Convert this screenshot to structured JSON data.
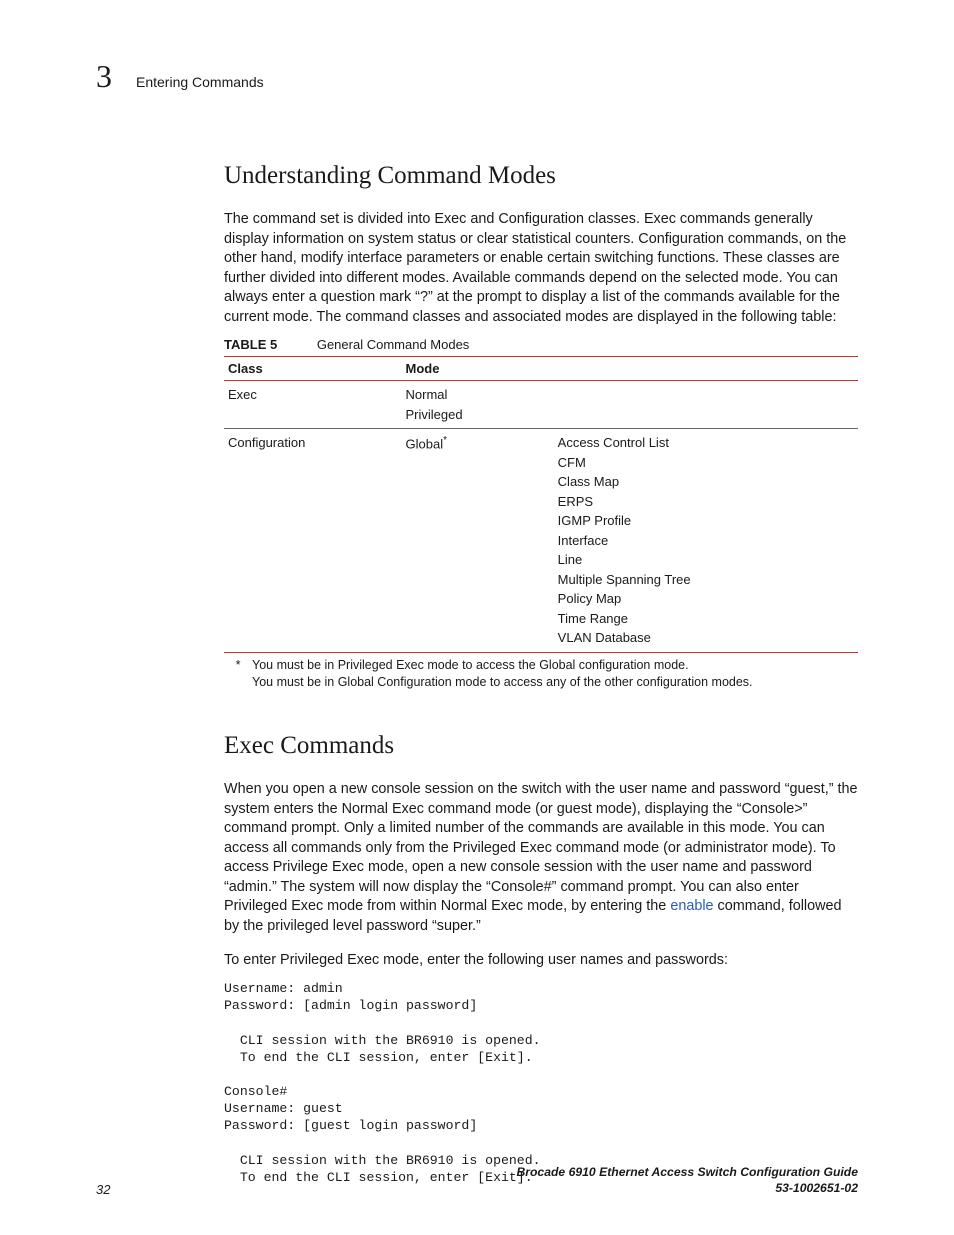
{
  "header": {
    "chapter_number": "3",
    "chapter_label": "Entering Commands"
  },
  "section1": {
    "title": "Understanding Command Modes",
    "para": "The command set is divided into Exec and Configuration classes. Exec commands generally display information on system status or clear statistical counters. Configuration commands, on the other hand, modify interface parameters or enable certain switching functions. These classes are further divided into different modes. Available commands depend on the selected mode. You can always enter a question mark “?” at the prompt to display a list of the commands available for the current mode. The command classes and associated modes are displayed in the following table:"
  },
  "table5": {
    "label": "TABLE 5",
    "title": "General Command Modes",
    "head_class": "Class",
    "head_mode": "Mode",
    "row_exec_class": "Exec",
    "row_exec_mode1": "Normal",
    "row_exec_mode2": "Privileged",
    "row_cfg_class": "Configuration",
    "row_cfg_mode": "Global",
    "cfg_sub": {
      "i0": "Access Control List",
      "i1": "CFM",
      "i2": "Class Map",
      "i3": "ERPS",
      "i4": "IGMP Profile",
      "i5": "Interface",
      "i6": "Line",
      "i7": "Multiple Spanning Tree",
      "i8": "Policy Map",
      "i9": "Time Range",
      "i10": "VLAN Database"
    }
  },
  "footnote": {
    "marker": "*",
    "line1": "You must be in Privileged Exec mode to access the Global configuration mode.",
    "line2": "You must be in Global Configuration mode to access any of the other configuration modes."
  },
  "section2": {
    "title": "Exec Commands",
    "para_pre": "When you open a new console session on the switch with the user name and password “guest,” the system enters the Normal Exec command mode (or guest mode), displaying the “Console>” command prompt. Only a limited number of the commands are available in this mode. You can access all commands only from the Privileged Exec command mode (or administrator mode). To access Privilege Exec mode, open a new console session with the user name and password “admin.” The system will now display the “Console#” command prompt. You can also enter Privileged Exec mode from within Normal Exec mode, by entering the ",
    "link_text": "enable",
    "para_post": " command, followed by the privileged level password “super.”",
    "para2": "To enter Privileged Exec mode, enter the following user names and passwords:",
    "code": "Username: admin\nPassword: [admin login password]\n\n  CLI session with the BR6910 is opened.\n  To end the CLI session, enter [Exit].\n\nConsole#\nUsername: guest\nPassword: [guest login password]\n\n  CLI session with the BR6910 is opened.\n  To end the CLI session, enter [Exit]."
  },
  "footer": {
    "page_no": "32",
    "guide": "Brocade 6910 Ethernet Access Switch Configuration Guide",
    "docid": "53-1002651-02"
  }
}
